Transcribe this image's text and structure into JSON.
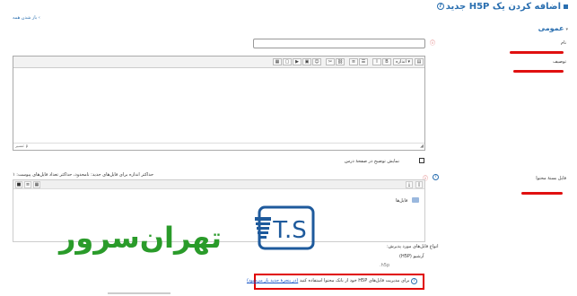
{
  "page": {
    "title": "اضافه کردن یک H5P جدید",
    "expand_all": "› باز شدن همه"
  },
  "section": {
    "general": "عمومی"
  },
  "fields": {
    "name_label": "نام",
    "name_value": "",
    "description_label": "توصیف",
    "path_label": "مسیر: p",
    "show_description": "نمایش توضیح در صفحهٔ درس",
    "package_label": "فایل بستهٔ محتوا",
    "max_size_note": "حداکثر اندازه برای فایل‌های جدید: نامحدود، حداکثر تعداد فایل‌های پیوست: ۱",
    "files_folder": "فایل‌ها",
    "accepted_types": "انواع فایل‌های مورد پذیرش:",
    "archive_type": "آرشیو (H5P)",
    "archive_ext": "h5p."
  },
  "editor": {
    "font_size": "اندازه"
  },
  "notice": {
    "text": "برای مدیریت فایل‌های H5P خود از بانک محتوا استفاده کنید",
    "link": "(در پنجرهٔ جدید باز می‌شود)"
  },
  "watermark": {
    "logo_letters": "T.S",
    "brand": "تهران‌سرور"
  },
  "colors": {
    "accent": "#2a6fb0",
    "redact": "#e01010",
    "brand_green": "#2a9b2a",
    "brand_blue": "#1e5a9c"
  }
}
